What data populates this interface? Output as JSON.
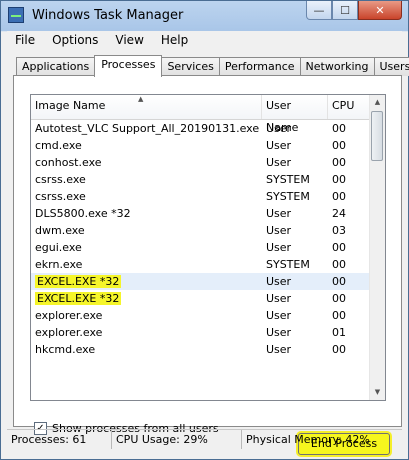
{
  "window": {
    "title": "Windows Task Manager",
    "min": "—",
    "max": "☐",
    "close": "✕"
  },
  "menu": [
    "File",
    "Options",
    "View",
    "Help"
  ],
  "tabs": [
    "Applications",
    "Processes",
    "Services",
    "Performance",
    "Networking",
    "Users"
  ],
  "active_tab": "Processes",
  "columns": [
    "Image Name",
    "User Name",
    "CPU"
  ],
  "processes": [
    {
      "name": "Autotest_VLC Support_All_20190131.exe *32",
      "user": "User",
      "cpu": "00"
    },
    {
      "name": "cmd.exe",
      "user": "User",
      "cpu": "00"
    },
    {
      "name": "conhost.exe",
      "user": "User",
      "cpu": "00"
    },
    {
      "name": "csrss.exe",
      "user": "SYSTEM",
      "cpu": "00"
    },
    {
      "name": "csrss.exe",
      "user": "SYSTEM",
      "cpu": "00"
    },
    {
      "name": "DLS5800.exe *32",
      "user": "User",
      "cpu": "24"
    },
    {
      "name": "dwm.exe",
      "user": "User",
      "cpu": "03"
    },
    {
      "name": "egui.exe",
      "user": "User",
      "cpu": "00"
    },
    {
      "name": "ekrn.exe",
      "user": "SYSTEM",
      "cpu": "00"
    },
    {
      "name": "EXCEL.EXE *32",
      "user": "User",
      "cpu": "00"
    },
    {
      "name": "EXCEL.EXE *32",
      "user": "User",
      "cpu": "00"
    },
    {
      "name": "explorer.exe",
      "user": "User",
      "cpu": "00"
    },
    {
      "name": "explorer.exe",
      "user": "User",
      "cpu": "01"
    },
    {
      "name": "hkcmd.exe",
      "user": "User",
      "cpu": "00"
    }
  ],
  "show_all_label": "Show processes from all users",
  "end_process_label": "End Process",
  "status": {
    "processes": "Processes: 61",
    "cpu": "CPU Usage: 29%",
    "memory": "Physical Memory: 42%"
  }
}
